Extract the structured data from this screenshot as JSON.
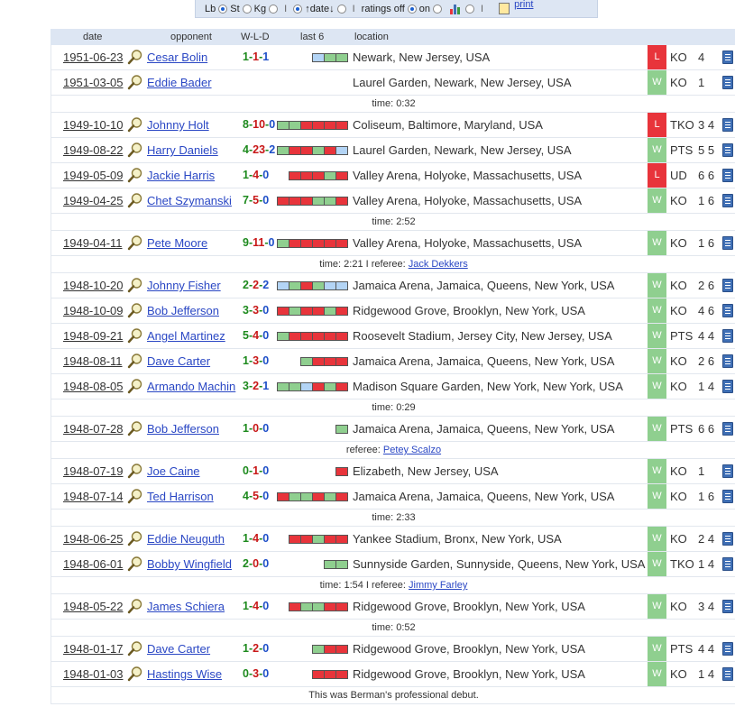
{
  "options": {
    "weight_units": [
      {
        "label": "Lb",
        "selected": true
      },
      {
        "label": "St",
        "selected": false
      },
      {
        "label": "Kg",
        "selected": false
      }
    ],
    "separator": "I",
    "sort": [
      {
        "label": "↑date↓",
        "selected": true
      },
      {
        "label": "",
        "selected": false
      }
    ],
    "ratings_off_label": "ratings off",
    "ratings_on_label": "on",
    "print_label": "print",
    "icons": {
      "chart": "bar-chart-icon",
      "print": "printer-icon"
    }
  },
  "columns": {
    "date": "date",
    "opponent": "opponent",
    "wld": "W-L-D",
    "last6": "last 6",
    "location": "location"
  },
  "colors": {
    "win": "#8fcf8f",
    "loss": "#e8343b",
    "draw": "#b3d4f5",
    "link": "#2a47c4",
    "header_bg": "#dde6f3"
  },
  "rows": [
    {
      "kind": "bout",
      "date": "1951-06-23",
      "opponent": "Cesar Bolin",
      "w": "1",
      "l": "1",
      "d": "1",
      "last6": [
        "D",
        "W",
        "W"
      ],
      "location": "Newark, New Jersey, USA",
      "result": "L",
      "type": "KO",
      "round": "4"
    },
    {
      "kind": "bout",
      "date": "1951-03-05",
      "opponent": "Eddie Bader",
      "w": "",
      "l": "",
      "d": "",
      "last6": [],
      "location": "Laurel Garden, Newark, New Jersey, USA",
      "result": "W",
      "type": "KO",
      "round": "1"
    },
    {
      "kind": "note",
      "text": "time: 0:32"
    },
    {
      "kind": "bout",
      "date": "1949-10-10",
      "opponent": "Johnny Holt",
      "w": "8",
      "l": "10",
      "d": "0",
      "last6": [
        "W",
        "W",
        "L",
        "L",
        "L",
        "L"
      ],
      "location": "Coliseum, Baltimore, Maryland, USA",
      "result": "L",
      "type": "TKO",
      "round": "3 4"
    },
    {
      "kind": "bout",
      "date": "1949-08-22",
      "opponent": "Harry Daniels",
      "w": "4",
      "l": "23",
      "d": "2",
      "last6": [
        "W",
        "L",
        "L",
        "W",
        "L",
        "D"
      ],
      "location": "Laurel Garden, Newark, New Jersey, USA",
      "result": "W",
      "type": "PTS",
      "round": "5 5"
    },
    {
      "kind": "bout",
      "date": "1949-05-09",
      "opponent": "Jackie Harris",
      "w": "1",
      "l": "4",
      "d": "0",
      "last6": [
        "L",
        "L",
        "L",
        "W",
        "L"
      ],
      "location": "Valley Arena, Holyoke, Massachusetts, USA",
      "result": "L",
      "type": "UD",
      "round": "6 6"
    },
    {
      "kind": "bout",
      "date": "1949-04-25",
      "opponent": "Chet Szymanski",
      "w": "7",
      "l": "5",
      "d": "0",
      "last6": [
        "L",
        "L",
        "L",
        "W",
        "W",
        "L"
      ],
      "location": "Valley Arena, Holyoke, Massachusetts, USA",
      "result": "W",
      "type": "KO",
      "round": "1 6"
    },
    {
      "kind": "note",
      "text": "time: 2:52"
    },
    {
      "kind": "bout",
      "date": "1949-04-11",
      "opponent": "Pete Moore",
      "w": "9",
      "l": "11",
      "d": "0",
      "last6": [
        "W",
        "L",
        "L",
        "L",
        "L",
        "L"
      ],
      "location": "Valley Arena, Holyoke, Massachusetts, USA",
      "result": "W",
      "type": "KO",
      "round": "1 6"
    },
    {
      "kind": "note",
      "text": "time: 2:21 I referee: ",
      "link": "Jack Dekkers"
    },
    {
      "kind": "bout",
      "date": "1948-10-20",
      "opponent": "Johnny Fisher",
      "w": "2",
      "l": "2",
      "d": "2",
      "last6": [
        "D",
        "W",
        "L",
        "W",
        "D",
        "D"
      ],
      "location": "Jamaica Arena, Jamaica, Queens, New York, USA",
      "result": "W",
      "type": "KO",
      "round": "2 6"
    },
    {
      "kind": "bout",
      "date": "1948-10-09",
      "opponent": "Bob Jefferson",
      "w": "3",
      "l": "3",
      "d": "0",
      "last6": [
        "L",
        "W",
        "L",
        "L",
        "W",
        "L"
      ],
      "location": "Ridgewood Grove, Brooklyn, New York, USA",
      "result": "W",
      "type": "KO",
      "round": "4 6"
    },
    {
      "kind": "bout",
      "date": "1948-09-21",
      "opponent": "Angel Martinez",
      "w": "5",
      "l": "4",
      "d": "0",
      "last6": [
        "W",
        "L",
        "L",
        "L",
        "L",
        "L"
      ],
      "location": "Roosevelt Stadium, Jersey City, New Jersey, USA",
      "result": "W",
      "type": "PTS",
      "round": "4 4"
    },
    {
      "kind": "bout",
      "date": "1948-08-11",
      "opponent": "Dave Carter",
      "w": "1",
      "l": "3",
      "d": "0",
      "last6": [
        "W",
        "L",
        "L",
        "L"
      ],
      "location": "Jamaica Arena, Jamaica, Queens, New York, USA",
      "result": "W",
      "type": "KO",
      "round": "2 6"
    },
    {
      "kind": "bout",
      "date": "1948-08-05",
      "opponent": "Armando Machin",
      "w": "3",
      "l": "2",
      "d": "1",
      "last6": [
        "W",
        "W",
        "D",
        "L",
        "W",
        "L"
      ],
      "location": "Madison Square Garden, New York, New York, USA",
      "result": "W",
      "type": "KO",
      "round": "1 4"
    },
    {
      "kind": "note",
      "text": "time: 0:29"
    },
    {
      "kind": "bout",
      "date": "1948-07-28",
      "opponent": "Bob Jefferson",
      "w": "1",
      "l": "0",
      "d": "0",
      "last6": [
        "W"
      ],
      "location": "Jamaica Arena, Jamaica, Queens, New York, USA",
      "result": "W",
      "type": "PTS",
      "round": "6 6"
    },
    {
      "kind": "note",
      "text": "referee: ",
      "link": "Petey Scalzo"
    },
    {
      "kind": "bout",
      "date": "1948-07-19",
      "opponent": "Joe Caine",
      "w": "0",
      "l": "1",
      "d": "0",
      "last6": [
        "L"
      ],
      "location": "Elizabeth, New Jersey, USA",
      "result": "W",
      "type": "KO",
      "round": "1"
    },
    {
      "kind": "bout",
      "date": "1948-07-14",
      "opponent": "Ted Harrison",
      "w": "4",
      "l": "5",
      "d": "0",
      "last6": [
        "L",
        "W",
        "W",
        "L",
        "W",
        "L"
      ],
      "location": "Jamaica Arena, Jamaica, Queens, New York, USA",
      "result": "W",
      "type": "KO",
      "round": "1 6"
    },
    {
      "kind": "note",
      "text": "time: 2:33"
    },
    {
      "kind": "bout",
      "date": "1948-06-25",
      "opponent": "Eddie Neuguth",
      "w": "1",
      "l": "4",
      "d": "0",
      "last6": [
        "L",
        "L",
        "W",
        "L",
        "L"
      ],
      "location": "Yankee Stadium, Bronx, New York, USA",
      "result": "W",
      "type": "KO",
      "round": "2 4"
    },
    {
      "kind": "bout",
      "date": "1948-06-01",
      "opponent": "Bobby Wingfield",
      "w": "2",
      "l": "0",
      "d": "0",
      "last6": [
        "W",
        "W"
      ],
      "location": "Sunnyside Garden, Sunnyside, Queens, New York, USA",
      "result": "W",
      "type": "TKO",
      "round": "1 4"
    },
    {
      "kind": "note",
      "text": "time: 1:54 I referee: ",
      "link": "Jimmy Farley"
    },
    {
      "kind": "bout",
      "date": "1948-05-22",
      "opponent": "James Schiera",
      "w": "1",
      "l": "4",
      "d": "0",
      "last6": [
        "L",
        "W",
        "W",
        "L",
        "L"
      ],
      "location": "Ridgewood Grove, Brooklyn, New York, USA",
      "result": "W",
      "type": "KO",
      "round": "3 4"
    },
    {
      "kind": "note",
      "text": "time: 0:52"
    },
    {
      "kind": "bout",
      "date": "1948-01-17",
      "opponent": "Dave Carter",
      "w": "1",
      "l": "2",
      "d": "0",
      "last6": [
        "W",
        "L",
        "L"
      ],
      "location": "Ridgewood Grove, Brooklyn, New York, USA",
      "result": "W",
      "type": "PTS",
      "round": "4 4"
    },
    {
      "kind": "bout",
      "date": "1948-01-03",
      "opponent": "Hastings Wise",
      "w": "0",
      "l": "3",
      "d": "0",
      "last6": [
        "L",
        "L",
        "L"
      ],
      "location": "Ridgewood Grove, Brooklyn, New York, USA",
      "result": "W",
      "type": "KO",
      "round": "1 4"
    },
    {
      "kind": "note",
      "text": "This was Berman's professional debut."
    }
  ]
}
